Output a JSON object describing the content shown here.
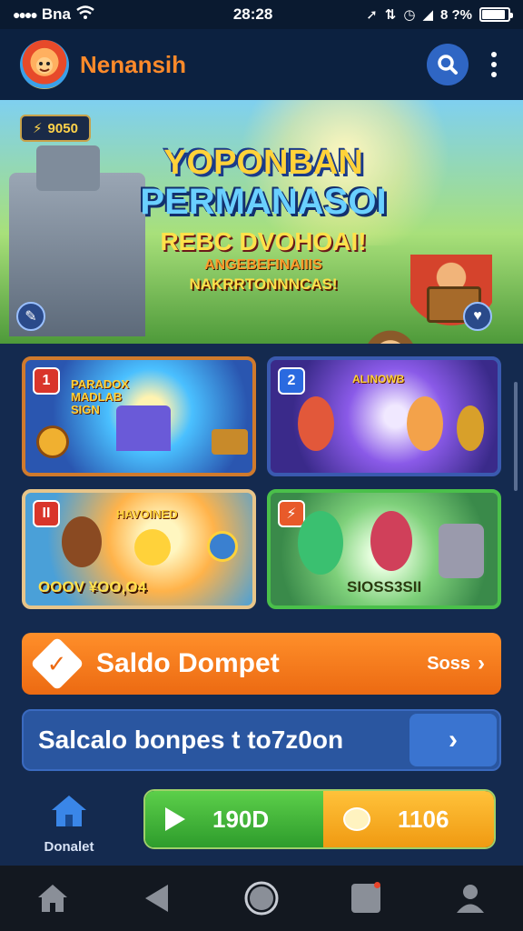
{
  "status_bar": {
    "carrier": "Bna",
    "time": "28:28",
    "battery_text": "8 ?%",
    "battery_level": 0.9
  },
  "header": {
    "app_name": "Nenansih",
    "icons": {
      "logo": "mascot-logo-icon",
      "search": "search-icon",
      "menu": "more-vertical-icon"
    }
  },
  "banner": {
    "coins": "9050",
    "title_line1": "YOPONBAN",
    "title_line2": "PERMANASOI",
    "title_line3": "REBC DVOHOAI!",
    "subtitle_line1": "ANGEBEFINAIIIS",
    "subtitle_line2": "NAKRRTONNNCAS!"
  },
  "tiles": [
    {
      "badge": "1",
      "tag": "PARADOX MADLAB SIGN",
      "caption": ""
    },
    {
      "badge": "2",
      "tag": "ALINOWB",
      "caption": ""
    },
    {
      "badge": "II",
      "tag": "HAVOINED",
      "caption": "OOOV ¥OO,O4"
    },
    {
      "badge": "⚡",
      "tag": "",
      "caption": "SIOSS3SII"
    }
  ],
  "saldo": {
    "label": "Saldo Dompet",
    "value": "Soss"
  },
  "bonus": {
    "label": "Salcalo bonpes t to7z0on"
  },
  "dash": {
    "home_label": "Donalet",
    "play_value": "190D",
    "coin_value": "1106"
  },
  "colors": {
    "accent_orange": "#ec6a12",
    "accent_blue": "#2a56a0",
    "accent_green": "#2e9c2c",
    "accent_gold": "#f09a12",
    "background": "#142a4f"
  }
}
